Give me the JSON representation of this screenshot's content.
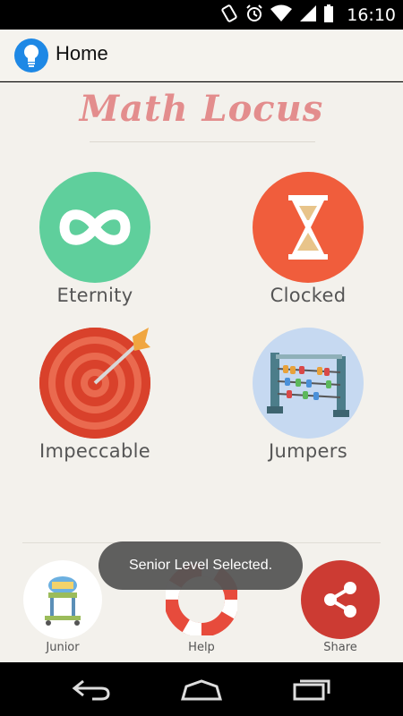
{
  "status_bar": {
    "time": "16:10",
    "icons": [
      "rotate-icon",
      "alarm-icon",
      "wifi-icon",
      "signal-icon",
      "battery-icon"
    ]
  },
  "app_bar": {
    "title": "Home",
    "logo_icon": "lightbulb-icon"
  },
  "brand": {
    "title": "Math Locus"
  },
  "modes": [
    {
      "label": "Eternity",
      "icon": "infinity-icon",
      "color": "#5fcf9c"
    },
    {
      "label": "Clocked",
      "icon": "hourglass-icon",
      "color": "#f05d3c"
    },
    {
      "label": "Impeccable",
      "icon": "target-icon",
      "color": "#d9412b"
    },
    {
      "label": "Jumpers",
      "icon": "abacus-icon",
      "color": "#c6d9f1"
    }
  ],
  "bottom_actions": [
    {
      "label": "Junior",
      "icon": "baby-walker-icon"
    },
    {
      "label": "Help",
      "icon": "lifebuoy-icon"
    },
    {
      "label": "Share",
      "icon": "share-icon",
      "color": "#cc3b33"
    }
  ],
  "toast": {
    "message": "Senior Level Selected."
  },
  "nav_bar": {
    "buttons": [
      "back-icon",
      "home-icon",
      "recents-icon"
    ]
  }
}
